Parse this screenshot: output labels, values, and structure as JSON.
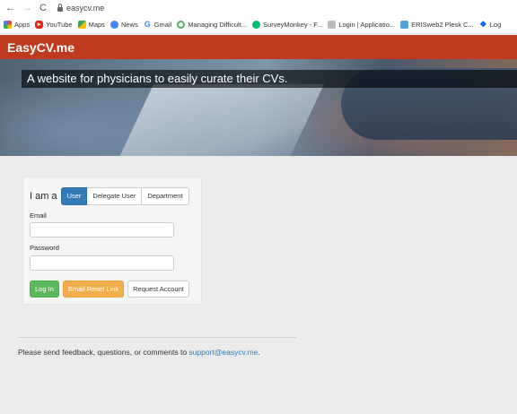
{
  "browser": {
    "url": "easycv.me",
    "bookmarks": [
      {
        "label": "Apps",
        "icon": "apps-icon"
      },
      {
        "label": "YouTube",
        "icon": "youtube-icon"
      },
      {
        "label": "Maps",
        "icon": "maps-icon"
      },
      {
        "label": "News",
        "icon": "news-icon"
      },
      {
        "label": "Gmail",
        "icon": "google-icon"
      },
      {
        "label": "Managing Difficult...",
        "icon": "circle-icon"
      },
      {
        "label": "SurveyMonkey - F...",
        "icon": "surveymonkey-icon"
      },
      {
        "label": "Login | Applicatio...",
        "icon": "grid-icon"
      },
      {
        "label": "ERISweb2 Plesk C...",
        "icon": "plesk-icon"
      },
      {
        "label": "Log",
        "icon": "dropbox-icon"
      }
    ]
  },
  "site": {
    "brand": "EasyCV.me",
    "tagline": "A website for physicians to easily curate their CVs.",
    "brand_color": "#bf3a1f"
  },
  "login": {
    "role_label": "I am a",
    "roles": [
      "User",
      "Delegate User",
      "Department"
    ],
    "active_role": "User",
    "email_label": "Email",
    "email_value": "",
    "password_label": "Password",
    "password_value": "",
    "login_button": "Log In",
    "reset_button": "Email Reset Link",
    "request_button": "Request Account"
  },
  "footer": {
    "text": "Please send feedback, questions, or comments to ",
    "email": "support@easycv.me",
    "suffix": "."
  }
}
